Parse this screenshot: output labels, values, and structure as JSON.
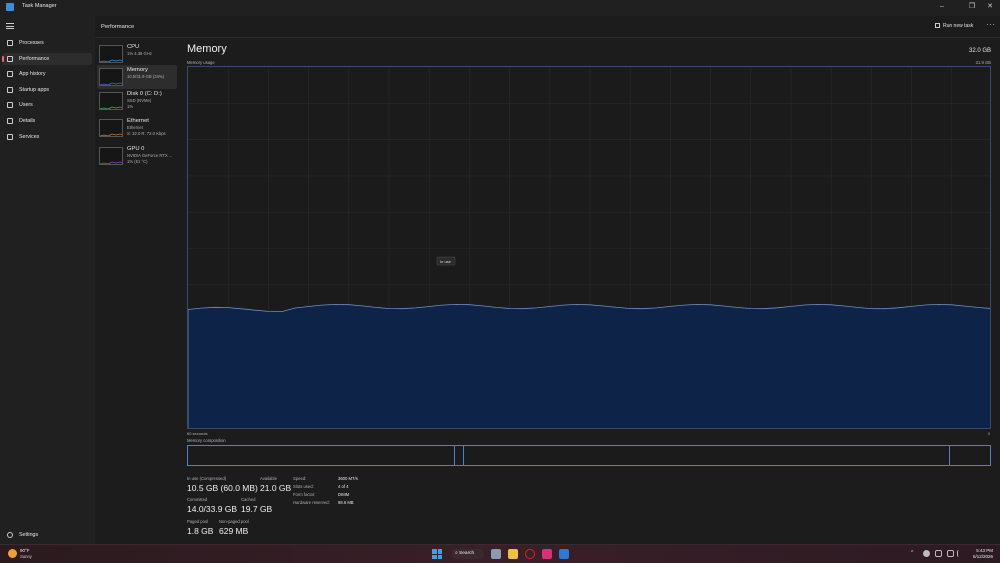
{
  "window": {
    "title": "Task Manager",
    "controls": {
      "minimize": "–",
      "restore": "❐",
      "close": "✕"
    }
  },
  "nav": {
    "items": [
      {
        "label": "Processes",
        "icon": "processes-icon"
      },
      {
        "label": "Performance",
        "icon": "performance-icon",
        "active": true
      },
      {
        "label": "App history",
        "icon": "app-history-icon"
      },
      {
        "label": "Startup apps",
        "icon": "startup-apps-icon"
      },
      {
        "label": "Users",
        "icon": "users-icon"
      },
      {
        "label": "Details",
        "icon": "details-icon"
      },
      {
        "label": "Services",
        "icon": "services-icon"
      }
    ],
    "settings_label": "Settings"
  },
  "header": {
    "title": "Performance",
    "run_new_task": "Run new task",
    "more": "···"
  },
  "resources": [
    {
      "name": "CPU",
      "sub1": "1% 4.38 GHz",
      "sub2": "",
      "color": "#3b8fd6"
    },
    {
      "name": "Memory",
      "sub1": "10.5/31.9 GB (34%)",
      "sub2": "",
      "color": "#3b6fd6",
      "selected": true
    },
    {
      "name": "Disk 0 (C: D:)",
      "sub1": "SSD (NVMe)",
      "sub2": "1%",
      "color": "#4caf50"
    },
    {
      "name": "Ethernet",
      "sub1": "Ethernet",
      "sub2": "S: 32.0  R: 72.0 Kbps",
      "color": "#c87a3a"
    },
    {
      "name": "GPU 0",
      "sub1": "NVIDIA GeForce RTX ...",
      "sub2": "1% (51 °C)",
      "color": "#a040c0"
    }
  ],
  "memory": {
    "title": "Memory",
    "total": "32.0 GB",
    "usage_label": "Memory usage",
    "usage_max": "31.9 GB",
    "tooltip": "In use",
    "time_left": "60 seconds",
    "time_right": "0",
    "composition_label": "Memory composition",
    "usage_fraction": 0.34,
    "stats": {
      "in_use_label": "In use (Compressed)",
      "in_use_value": "10.5 GB (60.0 MB)",
      "available_label": "Available",
      "available_value": "21.0 GB",
      "committed_label": "Committed",
      "committed_value": "14.0/33.9 GB",
      "cached_label": "Cached",
      "cached_value": "19.7 GB",
      "paged_pool_label": "Paged pool",
      "paged_pool_value": "1.8 GB",
      "non_paged_pool_label": "Non-paged pool",
      "non_paged_pool_value": "629 MB"
    },
    "details": [
      {
        "label": "Speed:",
        "value": "3600 MT/s"
      },
      {
        "label": "Slots used:",
        "value": "4 of 4"
      },
      {
        "label": "Form factor:",
        "value": "DIMM"
      },
      {
        "label": "Hardware reserved:",
        "value": "98.6 MB"
      }
    ]
  },
  "taskbar": {
    "weather_temp": "90°F",
    "weather_cond": "Sunny",
    "search_label": "Search",
    "tray_chevron": "^",
    "clock_time": "5:43 PM",
    "clock_date": "6/12/2026"
  }
}
